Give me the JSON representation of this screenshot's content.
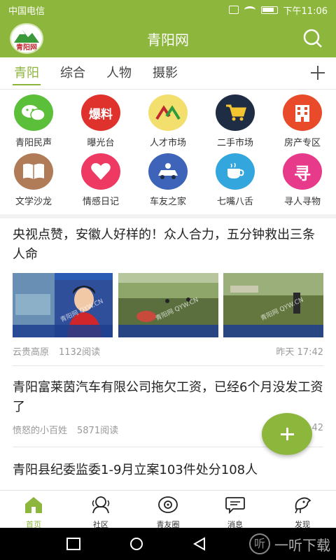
{
  "status_bar": {
    "carrier": "中国电信",
    "time": "下午11:06"
  },
  "header": {
    "title": "青阳网",
    "logo_text": "青阳网"
  },
  "tabs": [
    {
      "label": "青阳",
      "active": true
    },
    {
      "label": "综合",
      "active": false
    },
    {
      "label": "人物",
      "active": false
    },
    {
      "label": "摄影",
      "active": false
    }
  ],
  "categories": [
    {
      "label": "青阳民声",
      "icon": "wechat-icon",
      "color": "#5cbf3a"
    },
    {
      "label": "曝光台",
      "icon": "exposure-icon",
      "glyph": "爆料",
      "color": "#e0322d"
    },
    {
      "label": "人才市场",
      "icon": "talent-icon",
      "color": "#f3df6e"
    },
    {
      "label": "二手市场",
      "icon": "cart-icon",
      "color": "#1e2d44"
    },
    {
      "label": "房产专区",
      "icon": "building-icon",
      "color": "#e84a2a"
    },
    {
      "label": "文学沙龙",
      "icon": "book-icon",
      "color": "#b07b57"
    },
    {
      "label": "情感日记",
      "icon": "heart-icon",
      "color": "#ee3a62"
    },
    {
      "label": "车友之家",
      "icon": "car-icon",
      "color": "#3d64b8"
    },
    {
      "label": "七嘴八舌",
      "icon": "coffee-icon",
      "color": "#34a6de"
    },
    {
      "label": "寻人寻物",
      "icon": "search-person-icon",
      "glyph": "寻",
      "color": "#e83a8a"
    }
  ],
  "articles": [
    {
      "headline": "央视点赞，安徽人好样的！众人合力，五分钟救出三条人命",
      "source": "云贵高原",
      "reads": "1132阅读",
      "time": "昨天 17:42",
      "thumb_captions": [
        "青阳网 QYW.CN",
        "青阳网 QYW.CN",
        "青阳网 QYW.CN"
      ]
    },
    {
      "headline": "青阳富莱茵汽车有限公司拖欠工资，已经6个月没发工资了",
      "source": "愤怒的小百姓",
      "reads": "5871阅读",
      "time": "42"
    },
    {
      "headline": "青阳县纪委监委1-9月立案103件处分108人"
    }
  ],
  "bottom_nav": [
    {
      "label": "首页",
      "icon": "home-icon",
      "active": true
    },
    {
      "label": "社区",
      "icon": "community-icon",
      "active": false
    },
    {
      "label": "青友圈",
      "icon": "friends-circle-icon",
      "active": false
    },
    {
      "label": "消息",
      "icon": "message-icon",
      "active": false
    },
    {
      "label": "发现",
      "icon": "discover-icon",
      "active": false
    }
  ],
  "watermark": {
    "logo": "听",
    "text": "一听下载"
  }
}
